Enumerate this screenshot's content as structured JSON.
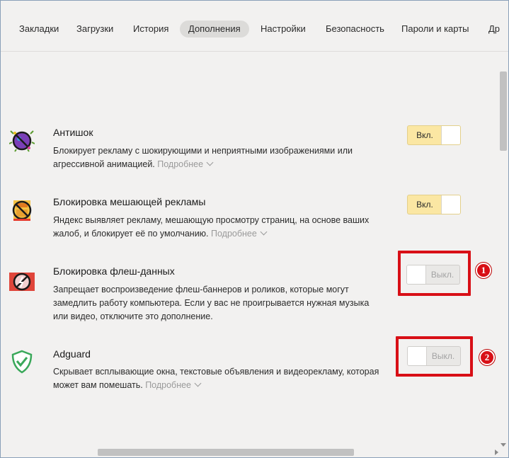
{
  "nav": {
    "items": [
      {
        "label": "Закладки"
      },
      {
        "label": "Загрузки"
      },
      {
        "label": "История"
      },
      {
        "label": "Дополнения",
        "active": true
      },
      {
        "label": "Настройки"
      },
      {
        "label": "Безопасность"
      },
      {
        "label": "Пароли и карты"
      },
      {
        "label": "Др"
      }
    ]
  },
  "extensions": [
    {
      "title": "Антишок",
      "description": "Блокирует рекламу с шокирующими и неприятными изображениями или агрессивной анимацией.",
      "more": "Подробнее",
      "state": "on",
      "toggle_label": "Вкл.",
      "icon": "antishock-icon"
    },
    {
      "title": "Блокировка мешающей рекламы",
      "description": "Яндекс выявляет рекламу, мешающую просмотру страниц, на основе ваших жалоб, и блокирует её по умолчанию.",
      "more": "Подробнее",
      "state": "on",
      "toggle_label": "Вкл.",
      "icon": "ad-block-icon"
    },
    {
      "title": "Блокировка флеш-данных",
      "description": "Запрещает воспроизведение флеш-баннеров и роликов, которые могут замедлить работу компьютера. Если у вас не проигрывается нужная музыка или видео, отключите это дополнение.",
      "state": "off",
      "toggle_label": "Выкл.",
      "icon": "flash-block-icon"
    },
    {
      "title": "Adguard",
      "description": "Скрывает всплывающие окна, текстовые объявления и видеорекламу, которая может вам помешать.",
      "more": "Подробнее",
      "state": "off",
      "toggle_label": "Выкл.",
      "icon": "adguard-shield-icon"
    }
  ],
  "annotations": [
    {
      "number": "1"
    },
    {
      "number": "2"
    }
  ],
  "colors": {
    "highlight": "#d80f16",
    "toggle_on": "#fbe7a3",
    "background": "#f2f1f0"
  }
}
